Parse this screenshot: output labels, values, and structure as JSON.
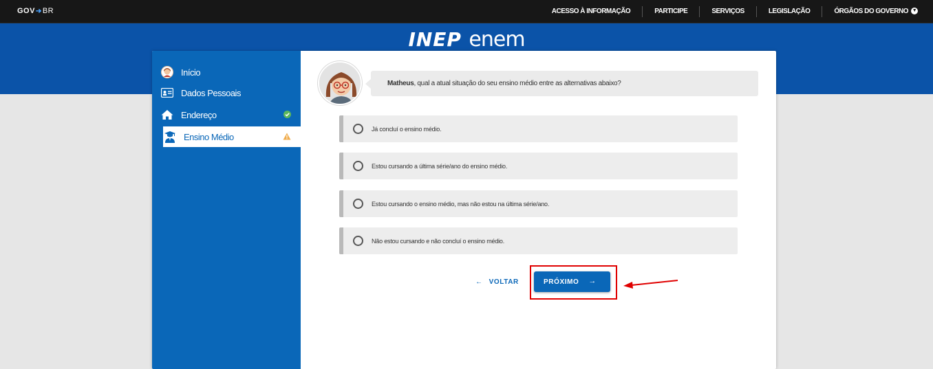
{
  "gov": {
    "logo_gov": "GOV",
    "logo_br": "BR",
    "links": [
      "ACESSO À INFORMAÇÃO",
      "PARTICIPE",
      "SERVIÇOS",
      "LEGISLAÇÃO",
      "ÓRGÃOS DO GOVERNO"
    ]
  },
  "brand": {
    "inep": "INEP",
    "enem": "enem"
  },
  "sidebar": {
    "items": [
      {
        "label": "Início",
        "icon": "user-avatar-icon"
      },
      {
        "label": "Dados Pessoais",
        "icon": "id-card-icon"
      },
      {
        "label": "Endereço",
        "icon": "home-icon",
        "status": "check-circle-icon"
      },
      {
        "label": "Ensino Médio",
        "icon": "graduate-icon",
        "status": "warning-icon",
        "active": true
      }
    ]
  },
  "question": {
    "name": "Matheus",
    "text": ", qual a atual situação do seu ensino médio entre as alternativas abaixo?"
  },
  "options": [
    "Já concluí o ensino médio.",
    "Estou cursando a última série/ano do ensino médio.",
    "Estou cursando o ensino médio, mas não estou na última série/ano.",
    "Não estou cursando e não concluí o ensino médio."
  ],
  "buttons": {
    "back": "VOLTAR",
    "next": "PRÓXIMO"
  },
  "colors": {
    "primary": "#0a67b8",
    "banner": "#0b53a8",
    "govbar": "#171717",
    "highlight": "#e00000",
    "success": "#5cb85c",
    "warning": "#f0ad4e"
  }
}
